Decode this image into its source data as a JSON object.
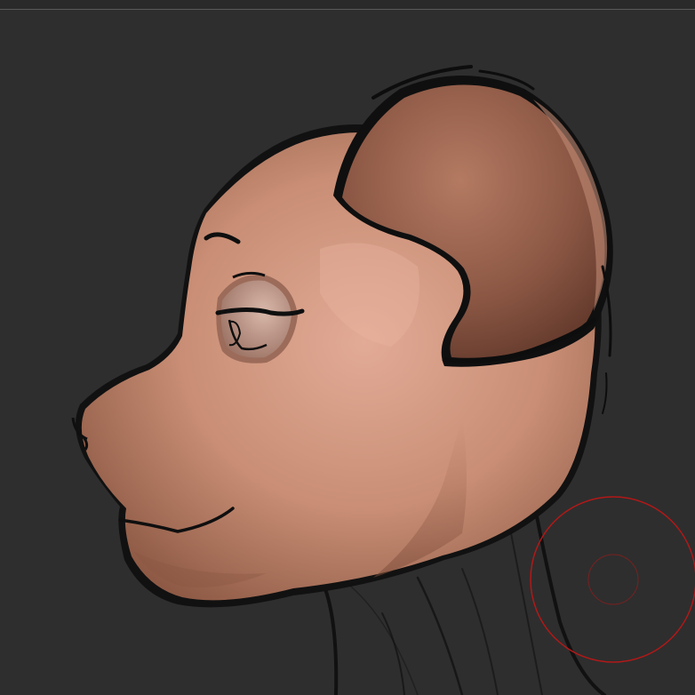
{
  "app": {
    "canvas_background": "#2e2e2e",
    "viewport_border_color": "#5a5a5a"
  },
  "model": {
    "subject": "stylized-feline-head-sculpt",
    "skin_color": "#c98e75",
    "ear_inner_color": "#8a5643",
    "outline_color": "#0f0f0f",
    "eye_white_color": "#c9a79a"
  },
  "brush_cursor": {
    "outer_ring_color": "#b31818",
    "inner_ring_color": "#7a2020",
    "icon": "brush-cursor-icon"
  }
}
